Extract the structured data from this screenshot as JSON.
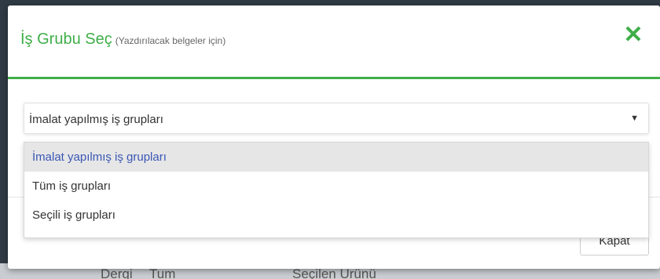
{
  "background": {
    "fragments": [
      "Dergi",
      "Tum",
      "Seçilen Ürünü"
    ]
  },
  "modal": {
    "title": "İş Grubu Seç",
    "subtitle": "(Yazdırılacak belgeler için)",
    "close_icon": "close-x-icon",
    "accent_color": "#3fae49"
  },
  "select": {
    "value": "İmalat yapılmış iş grupları",
    "arrow_icon": "caret-down-icon",
    "options": [
      {
        "label": "İmalat yapılmış iş grupları",
        "selected": true
      },
      {
        "label": "Tüm iş grupları",
        "selected": false
      },
      {
        "label": "Seçili iş grupları",
        "selected": false
      }
    ]
  },
  "footer": {
    "close_label": "Kapat"
  }
}
